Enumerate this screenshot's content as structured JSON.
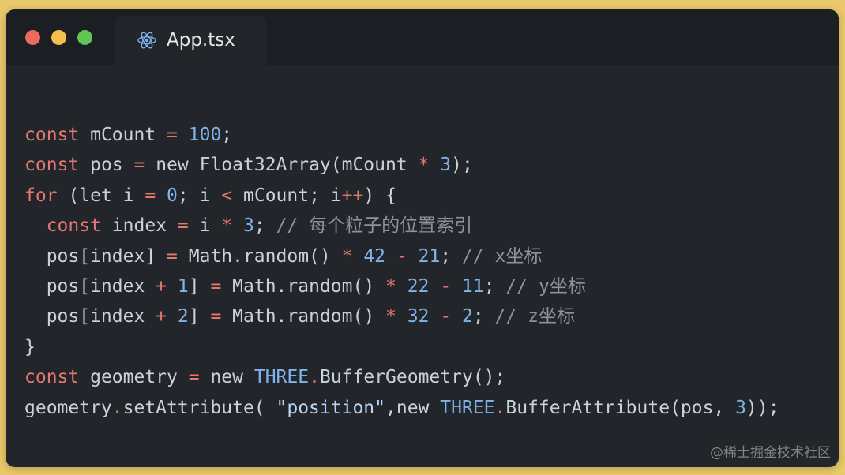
{
  "window": {
    "controls": [
      "close",
      "minimize",
      "zoom"
    ],
    "colors": {
      "background": "#22262b",
      "titlebar": "#1b1e22",
      "close": "#ec6a5f",
      "minimize": "#f5bf4f",
      "zoom": "#61c554",
      "outer": "#e9c96a"
    }
  },
  "tab": {
    "icon": "react-icon",
    "label": "App.tsx"
  },
  "code": {
    "lines": [
      [
        [
          "kw",
          "const"
        ],
        [
          "txt",
          " mCount "
        ],
        [
          "op",
          "="
        ],
        [
          "txt",
          " "
        ],
        [
          "num",
          "100"
        ],
        [
          "txt",
          ";"
        ]
      ],
      [
        [
          "kw",
          "const"
        ],
        [
          "txt",
          " pos "
        ],
        [
          "op",
          "="
        ],
        [
          "txt",
          " new Float32Array(mCount "
        ],
        [
          "op",
          "*"
        ],
        [
          "txt",
          " "
        ],
        [
          "num",
          "3"
        ],
        [
          "txt",
          ");"
        ]
      ],
      [
        [
          "kw",
          "for"
        ],
        [
          "txt",
          " (let i "
        ],
        [
          "op",
          "="
        ],
        [
          "txt",
          " "
        ],
        [
          "num",
          "0"
        ],
        [
          "txt",
          "; i "
        ],
        [
          "op",
          "<"
        ],
        [
          "txt",
          " mCount; i"
        ],
        [
          "op",
          "++"
        ],
        [
          "txt",
          ") {"
        ]
      ],
      [
        [
          "txt",
          "  "
        ],
        [
          "kw",
          "const"
        ],
        [
          "txt",
          " index "
        ],
        [
          "op",
          "="
        ],
        [
          "txt",
          " i "
        ],
        [
          "op",
          "*"
        ],
        [
          "txt",
          " "
        ],
        [
          "num",
          "3"
        ],
        [
          "txt",
          "; "
        ],
        [
          "cmt",
          "// 每个粒子的位置索引"
        ]
      ],
      [
        [
          "txt",
          "  pos[index] "
        ],
        [
          "op",
          "="
        ],
        [
          "txt",
          " Math.random() "
        ],
        [
          "op",
          "*"
        ],
        [
          "txt",
          " "
        ],
        [
          "num",
          "42"
        ],
        [
          "txt",
          " "
        ],
        [
          "op",
          "-"
        ],
        [
          "txt",
          " "
        ],
        [
          "num",
          "21"
        ],
        [
          "txt",
          "; "
        ],
        [
          "cmt",
          "// x坐标"
        ]
      ],
      [
        [
          "txt",
          "  pos[index "
        ],
        [
          "op",
          "+"
        ],
        [
          "txt",
          " "
        ],
        [
          "num",
          "1"
        ],
        [
          "txt",
          "] "
        ],
        [
          "op",
          "="
        ],
        [
          "txt",
          " Math.random() "
        ],
        [
          "op",
          "*"
        ],
        [
          "txt",
          " "
        ],
        [
          "num",
          "22"
        ],
        [
          "txt",
          " "
        ],
        [
          "op",
          "-"
        ],
        [
          "txt",
          " "
        ],
        [
          "num",
          "11"
        ],
        [
          "txt",
          "; "
        ],
        [
          "cmt",
          "// y坐标"
        ]
      ],
      [
        [
          "txt",
          "  pos[index "
        ],
        [
          "op",
          "+"
        ],
        [
          "txt",
          " "
        ],
        [
          "num",
          "2"
        ],
        [
          "txt",
          "] "
        ],
        [
          "op",
          "="
        ],
        [
          "txt",
          " Math.random() "
        ],
        [
          "op",
          "*"
        ],
        [
          "txt",
          " "
        ],
        [
          "num",
          "32"
        ],
        [
          "txt",
          " "
        ],
        [
          "op",
          "-"
        ],
        [
          "txt",
          " "
        ],
        [
          "num",
          "2"
        ],
        [
          "txt",
          "; "
        ],
        [
          "cmt",
          "// z坐标"
        ]
      ],
      [
        [
          "txt",
          "}"
        ]
      ],
      [
        [
          "kw",
          "const"
        ],
        [
          "txt",
          " geometry "
        ],
        [
          "op",
          "="
        ],
        [
          "txt",
          " new "
        ],
        [
          "cls",
          "THREE"
        ],
        [
          "op",
          "."
        ],
        [
          "txt",
          "BufferGeometry();"
        ]
      ],
      [
        [
          "txt",
          "geometry"
        ],
        [
          "op",
          "."
        ],
        [
          "txt",
          "setAttribute( "
        ],
        [
          "str",
          "\"position\""
        ],
        [
          "txt",
          ",new "
        ],
        [
          "cls",
          "THREE"
        ],
        [
          "op",
          "."
        ],
        [
          "txt",
          "BufferAttribute(pos, "
        ],
        [
          "num",
          "3"
        ],
        [
          "txt",
          "));"
        ]
      ]
    ]
  },
  "watermark": "@稀土掘金技术社区"
}
